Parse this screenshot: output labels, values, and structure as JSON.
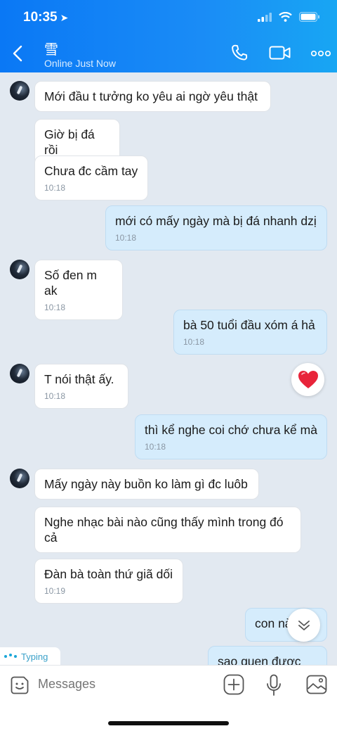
{
  "status_bar": {
    "time": "10:35"
  },
  "header": {
    "name": "雪",
    "status": "Online Just Now",
    "icons": [
      "back-icon",
      "phone-icon",
      "video-icon",
      "more-icon"
    ]
  },
  "messages": [
    {
      "dir": "in",
      "text": "Mới đầu t tưởng ko yêu ai ngờ yêu thật",
      "time": ""
    },
    {
      "dir": "in",
      "text": "Giờ bị đá rồi",
      "time": ""
    },
    {
      "dir": "in",
      "text": "Chưa đc cầm tay",
      "time": "10:18"
    },
    {
      "dir": "out",
      "text": "mới có mấy ngày mà bị đá nhanh dzị",
      "time": "10:18"
    },
    {
      "dir": "in",
      "text": "Số đen m ak",
      "time": "10:18"
    },
    {
      "dir": "out",
      "text": "bà 50 tuổi đầu xóm á hả",
      "time": "10:18"
    },
    {
      "dir": "in",
      "text": "T nói thật ấy.",
      "time": "10:18"
    },
    {
      "dir": "out",
      "text": "thì kể nghe coi chớ chưa kể mà",
      "time": "10:18"
    },
    {
      "dir": "in",
      "text": "Mấy ngày này buồn ko làm gì đc luôb",
      "time": ""
    },
    {
      "dir": "in",
      "text": "Nghe nhạc bài nào cũng thấy mình trong đó cả",
      "time": ""
    },
    {
      "dir": "in",
      "text": "Đàn bà toàn thứ giã dối",
      "time": "10:19"
    },
    {
      "dir": "out",
      "text": "con nà",
      "time": ""
    },
    {
      "dir": "out",
      "text": "sao quen được nó",
      "time": ""
    }
  ],
  "typing_label": "Typing",
  "composer": {
    "placeholder": "Messages"
  },
  "colors": {
    "header": "#1a8cf6",
    "outgoing": "#d5ecfc",
    "incoming": "#ffffff",
    "background": "#e2e9f1"
  }
}
